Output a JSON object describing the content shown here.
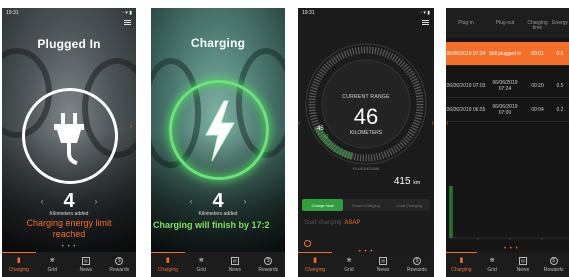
{
  "colors": {
    "accent": "#f36f2a",
    "charging_green": "#6be27a",
    "nav_bg": "#1c1c1c"
  },
  "status_bar": {
    "time": "19:31"
  },
  "nav": [
    {
      "label": "Charging",
      "icon": "charging-icon"
    },
    {
      "label": "Grid",
      "icon": "tower-icon"
    },
    {
      "label": "News",
      "icon": "news-icon"
    },
    {
      "label": "Rewards",
      "icon": "rewards-icon"
    }
  ],
  "screen1": {
    "title": "Plugged In",
    "km_count": "4",
    "km_label": "Kilometers added",
    "message_line1": "Charging energy limit",
    "message_line2": "reached",
    "icon": "plug-icon"
  },
  "screen2": {
    "title": "Charging",
    "km_count": "4",
    "km_label": "Kilometers added",
    "message": "Charging will finish by 17:2",
    "icon": "lightning-icon"
  },
  "screen3": {
    "range_label": "CURRENT RANGE",
    "range_value": "46",
    "range_unit": "KILOMETERS",
    "gauge_value": "45",
    "gauge_marker": "42",
    "plug_id": "PLUGGED346",
    "km_total": "415",
    "km_unit": "km",
    "tabs": [
      "Charge Now",
      "Smart Charging",
      "Goal Charging"
    ],
    "start_label": "Start charging:",
    "start_value": "ASAP"
  },
  "screen4": {
    "headers": [
      "Plug-in",
      "Plug-out",
      "Charging time",
      "Energy"
    ],
    "rows": [
      {
        "plugin": "06/06/2019 07:24",
        "plugout": "Still plugged in",
        "time": "00:01",
        "energy": "0.5"
      },
      {
        "plugin": "06/06/2019 07:03",
        "plugout": "06/06/2019 07:24",
        "time": "00:20",
        "energy": "0.5"
      },
      {
        "plugin": "06/06/2019 06:55",
        "plugout": "06/06/2019 07:00",
        "time": "00:04",
        "energy": "0.2"
      }
    ]
  }
}
